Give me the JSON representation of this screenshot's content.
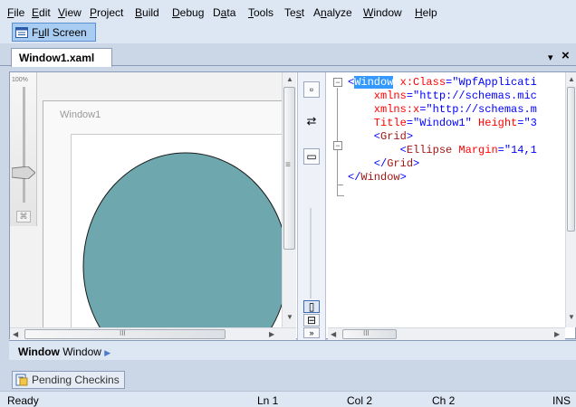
{
  "menu": {
    "items": [
      {
        "pre": "",
        "u": "F",
        "post": "ile"
      },
      {
        "pre": "",
        "u": "E",
        "post": "dit"
      },
      {
        "pre": "",
        "u": "V",
        "post": "iew"
      },
      {
        "pre": "",
        "u": "P",
        "post": "roject"
      },
      {
        "pre": "",
        "u": "B",
        "post": "uild"
      },
      {
        "pre": "",
        "u": "D",
        "post": "ebug"
      },
      {
        "pre": "D",
        "u": "a",
        "post": "ta"
      },
      {
        "pre": "",
        "u": "T",
        "post": "ools"
      },
      {
        "pre": "Te",
        "u": "s",
        "post": "t"
      },
      {
        "pre": "A",
        "u": "n",
        "post": "alyze"
      },
      {
        "pre": "",
        "u": "W",
        "post": "indow"
      },
      {
        "pre": "",
        "u": "H",
        "post": "elp"
      }
    ]
  },
  "toolbar": {
    "fullscreen": {
      "pre": "F",
      "u": "u",
      "post": "ll Screen"
    }
  },
  "document_tab": {
    "title": "Window1.xaml",
    "close_glyph": "×",
    "dropdown_glyph": "▾"
  },
  "designer": {
    "zoom_label": "100%",
    "window_title": "Window1",
    "ellipse_fill": "#6ea8ae"
  },
  "xaml": {
    "lines": [
      {
        "parts": [
          {
            "t": "<",
            "c": "br"
          },
          {
            "t": "Window",
            "c": "tag",
            "sel": true
          },
          {
            "t": " x:Class",
            "c": "attr"
          },
          {
            "t": "=\"",
            "c": "br"
          },
          {
            "t": "WpfApplicati",
            "c": "val"
          }
        ]
      },
      {
        "parts": [
          {
            "t": "    xmlns",
            "c": "attr"
          },
          {
            "t": "=\"",
            "c": "br"
          },
          {
            "t": "http://schemas.mic",
            "c": "val"
          }
        ]
      },
      {
        "parts": [
          {
            "t": "    xmlns:x",
            "c": "attr"
          },
          {
            "t": "=\"",
            "c": "br"
          },
          {
            "t": "http://schemas.m",
            "c": "val"
          }
        ]
      },
      {
        "parts": [
          {
            "t": "    Title",
            "c": "attr"
          },
          {
            "t": "=\"",
            "c": "br"
          },
          {
            "t": "Window1",
            "c": "val"
          },
          {
            "t": "\"",
            "c": "br"
          },
          {
            "t": " Height",
            "c": "attr"
          },
          {
            "t": "=\"",
            "c": "br"
          },
          {
            "t": "3",
            "c": "val"
          }
        ]
      },
      {
        "parts": [
          {
            "t": "    <",
            "c": "br"
          },
          {
            "t": "Grid",
            "c": "tag"
          },
          {
            "t": ">",
            "c": "br"
          }
        ]
      },
      {
        "parts": [
          {
            "t": "        <",
            "c": "br"
          },
          {
            "t": "Ellipse",
            "c": "tag"
          },
          {
            "t": " Margin",
            "c": "attr"
          },
          {
            "t": "=\"",
            "c": "br"
          },
          {
            "t": "14,1",
            "c": "val"
          }
        ]
      },
      {
        "parts": [
          {
            "t": "    </",
            "c": "br"
          },
          {
            "t": "Grid",
            "c": "tag"
          },
          {
            "t": ">",
            "c": "br"
          }
        ]
      },
      {
        "parts": [
          {
            "t": "</",
            "c": "br"
          },
          {
            "t": "Window",
            "c": "tag"
          },
          {
            "t": ">",
            "c": "br"
          }
        ]
      }
    ]
  },
  "breadcrumb": {
    "bold": "Window",
    "plain": "Window"
  },
  "pending_tab": {
    "label": "Pending Checkins"
  },
  "status": {
    "ready": "Ready",
    "ln": "Ln 1",
    "col": "Col 2",
    "ch": "Ch 2",
    "ins": "INS"
  },
  "scroll_glyphs": {
    "hdots": "III",
    "vdots": "≡"
  }
}
